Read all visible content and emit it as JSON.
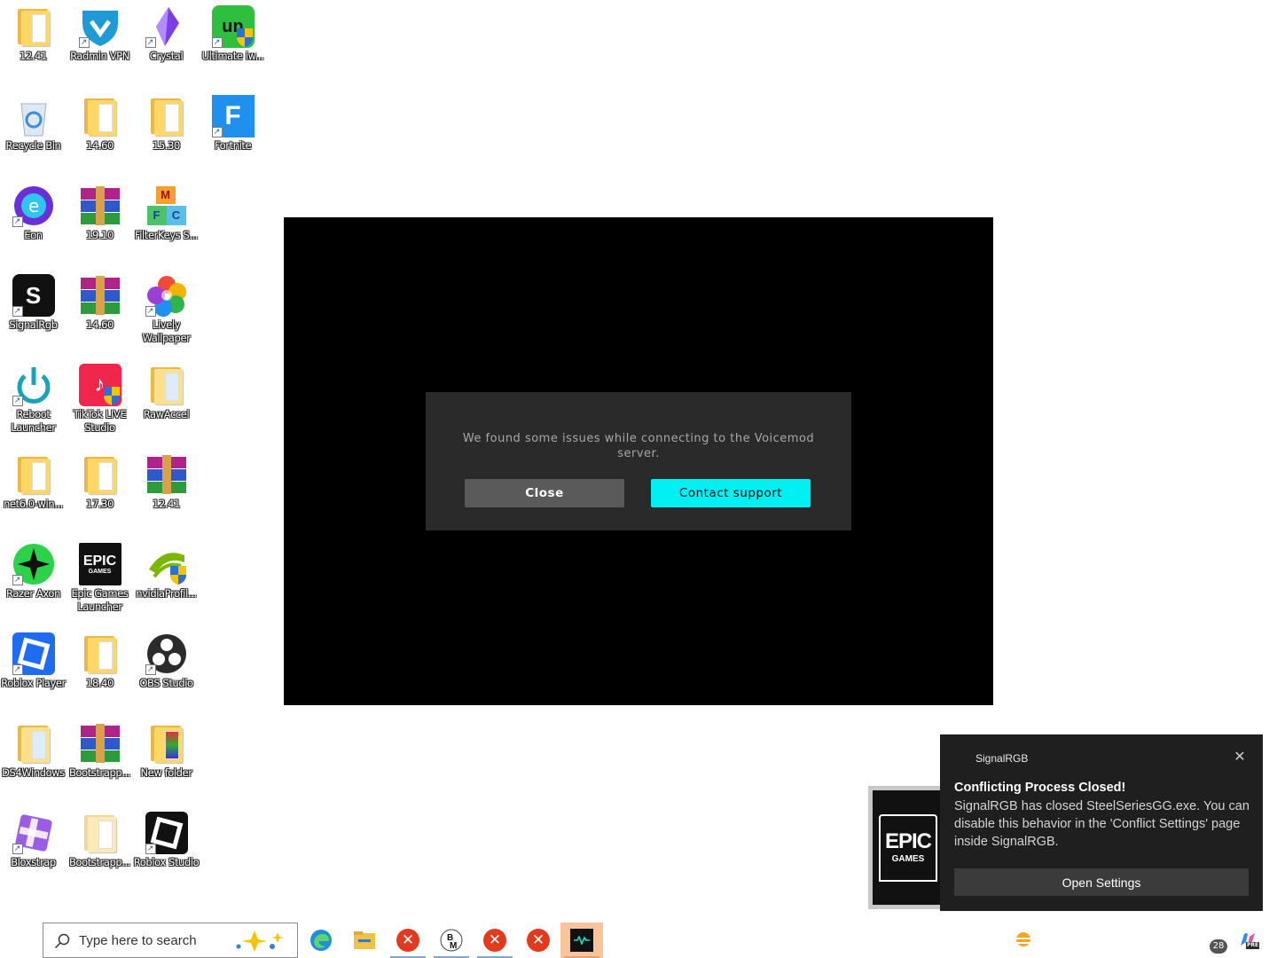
{
  "desktop": {
    "icons": [
      {
        "label": "12.41",
        "icon": "folder-icon"
      },
      {
        "label": "Radmin VPN",
        "icon": "radmin-vpn-icon"
      },
      {
        "label": "Crystal",
        "icon": "crystal-icon"
      },
      {
        "label": "Ultimate iw...",
        "icon": "ultimate-app-icon"
      },
      {
        "label": "Recycle Bin",
        "icon": "recycle-bin-icon"
      },
      {
        "label": "14.60",
        "icon": "folder-icon"
      },
      {
        "label": "15.30",
        "icon": "folder-icon"
      },
      {
        "label": "Fortnite",
        "icon": "fortnite-icon"
      },
      {
        "label": "Eon",
        "icon": "eon-icon"
      },
      {
        "label": "19.10",
        "icon": "winrar-archive-icon"
      },
      {
        "label": "FilterKeys S...",
        "icon": "filterkeys-icon"
      },
      {
        "label": "SignalRgb",
        "icon": "signalrgb-icon"
      },
      {
        "label": "14.60",
        "icon": "winrar-archive-icon"
      },
      {
        "label": "Lively Wallpaper",
        "icon": "lively-wallpaper-icon"
      },
      {
        "label": "Reboot Launcher",
        "icon": "reboot-launcher-icon"
      },
      {
        "label": "TikTok LIVE Studio",
        "icon": "tiktok-live-icon"
      },
      {
        "label": "RawAccel",
        "icon": "folder-icon"
      },
      {
        "label": "net6.0-win...",
        "icon": "folder-icon"
      },
      {
        "label": "17.30",
        "icon": "folder-icon"
      },
      {
        "label": "12.41",
        "icon": "winrar-archive-icon"
      },
      {
        "label": "Razer Axon",
        "icon": "razer-axon-icon"
      },
      {
        "label": "Epic Games Launcher",
        "icon": "epic-games-icon"
      },
      {
        "label": "nvidiaProfil...",
        "icon": "nvidia-profile-icon"
      },
      {
        "label": "Roblox Player",
        "icon": "roblox-player-icon"
      },
      {
        "label": "18.40",
        "icon": "folder-icon"
      },
      {
        "label": "OBS Studio",
        "icon": "obs-studio-icon"
      },
      {
        "label": "DS4Windows",
        "icon": "folder-icon"
      },
      {
        "label": "Bootstrapp...",
        "icon": "winrar-archive-icon"
      },
      {
        "label": "New folder",
        "icon": "folder-icon"
      },
      {
        "label": "Bloxstrap",
        "icon": "bloxstrap-icon"
      },
      {
        "label": "Bootstrapp...",
        "icon": "folder-icon"
      },
      {
        "label": "Roblox Studio",
        "icon": "roblox-studio-icon"
      }
    ]
  },
  "voicemod": {
    "message": "We found some issues while connecting to the Voicemod server.",
    "close_label": "Close",
    "support_label": "Contact support",
    "accent": "#00f0f4"
  },
  "toast": {
    "app": "SignalRGB",
    "title": "Conflicting Process Closed!",
    "body": "SignalRGB has closed SteelSeriesGG.exe. You can disable this behavior in the 'Conflict Settings' page inside SignalRGB.",
    "button": "Open Settings"
  },
  "epic_thumbnail": {
    "line1": "EPIC",
    "line2": "GAMES"
  },
  "taskbar": {
    "search_placeholder": "Type here to search",
    "notification_count": "28",
    "copilot_badge": "PRE"
  }
}
